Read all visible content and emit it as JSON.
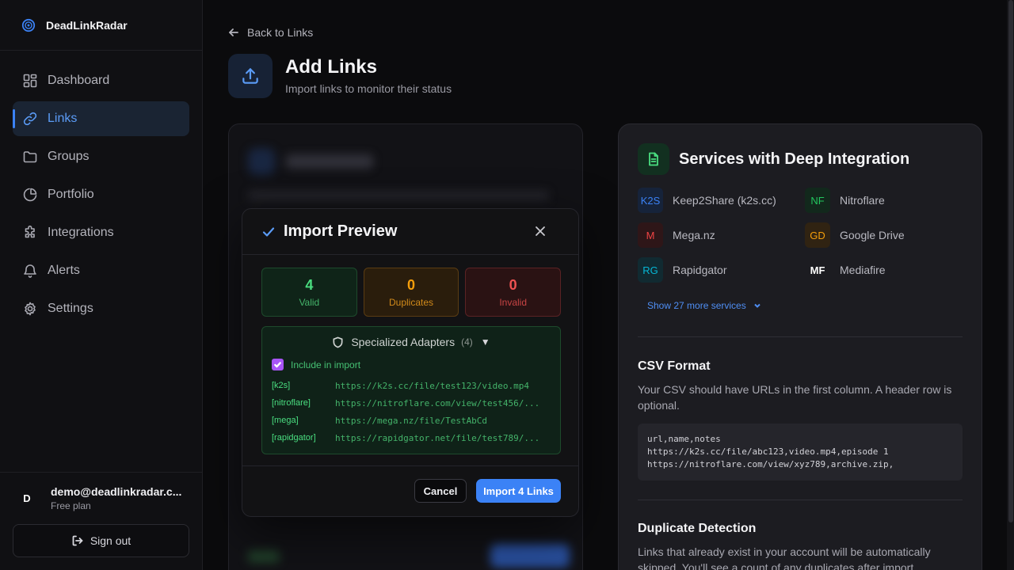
{
  "brand": {
    "name": "DeadLinkRadar"
  },
  "sidebar": {
    "items": [
      {
        "label": "Dashboard",
        "icon": "dashboard-icon"
      },
      {
        "label": "Links",
        "icon": "link-icon",
        "active": true
      },
      {
        "label": "Groups",
        "icon": "folder-icon"
      },
      {
        "label": "Portfolio",
        "icon": "pie-chart-icon"
      },
      {
        "label": "Integrations",
        "icon": "puzzle-icon"
      },
      {
        "label": "Alerts",
        "icon": "bell-icon"
      },
      {
        "label": "Settings",
        "icon": "gear-icon"
      }
    ]
  },
  "user": {
    "initial": "D",
    "email": "demo@deadlinkradar.c...",
    "plan": "Free plan",
    "signout_label": "Sign out"
  },
  "header": {
    "back_label": "Back to Links",
    "title": "Add Links",
    "subtitle": "Import links to monitor their status"
  },
  "modal": {
    "title": "Import Preview",
    "stats": {
      "valid": {
        "value": "4",
        "label": "Valid"
      },
      "duplicates": {
        "value": "0",
        "label": "Duplicates"
      },
      "invalid": {
        "value": "0",
        "label": "Invalid"
      }
    },
    "adapters": {
      "title": "Specialized Adapters",
      "count": "(4)",
      "caret": "▼",
      "include_label": "Include in import",
      "include_checked": true,
      "rows": [
        {
          "tag": "[k2s]",
          "url": "https://k2s.cc/file/test123/video.mp4"
        },
        {
          "tag": "[nitroflare]",
          "url": "https://nitroflare.com/view/test456/..."
        },
        {
          "tag": "[mega]",
          "url": "https://mega.nz/file/TestAbCd"
        },
        {
          "tag": "[rapidgator]",
          "url": "https://rapidgator.net/file/test789/..."
        }
      ]
    },
    "cancel_label": "Cancel",
    "import_label": "Import 4 Links"
  },
  "services": {
    "title": "Services with Deep Integration",
    "items": [
      {
        "badge": "K2S",
        "name": "Keep2Share (k2s.cc)",
        "color": "#3b82f6",
        "bg": "#16233a"
      },
      {
        "badge": "NF",
        "name": "Nitroflare",
        "color": "#22c55e",
        "bg": "#12281c"
      },
      {
        "badge": "M",
        "name": "Mega.nz",
        "color": "#ef4444",
        "bg": "#2e1618"
      },
      {
        "badge": "GD",
        "name": "Google Drive",
        "color": "#f59e0b",
        "bg": "#302312"
      },
      {
        "badge": "RG",
        "name": "Rapidgator",
        "color": "#06b6d4",
        "bg": "#112a31"
      },
      {
        "badge": "MF",
        "name": "Mediafire",
        "color": "#ffffff",
        "bg": "transparent"
      }
    ],
    "more_label": "Show 27 more services"
  },
  "csv": {
    "title": "CSV Format",
    "text": "Your CSV should have URLs in the first column. A header row is optional.",
    "code": "url,name,notes\nhttps://k2s.cc/file/abc123,video.mp4,episode 1\nhttps://nitroflare.com/view/xyz789,archive.zip,"
  },
  "duplicates": {
    "title": "Duplicate Detection",
    "text": "Links that already exist in your account will be automatically skipped. You'll see a count of any duplicates after import."
  }
}
